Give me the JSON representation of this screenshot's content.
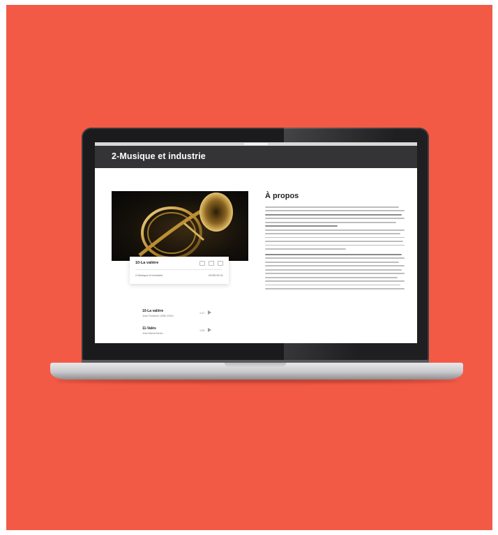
{
  "colors": {
    "background": "#f25a46",
    "hero_bar": "#343436",
    "laptop_bezel": "#1b1b1d"
  },
  "page": {
    "hero_title": "2-Musique et industrie",
    "about_title": "À propos"
  },
  "track_card": {
    "title": "10-La valière",
    "subtitle": "2-Musique et industrie",
    "count": "00/00:00:11"
  },
  "playlist": [
    {
      "title": "10-La valière",
      "subtitle": "Jean Fontanier (1980-2020)",
      "duration": "1:47"
    },
    {
      "title": "11-Valés",
      "subtitle": "Jean-Michel Beréc",
      "duration": "1:55"
    }
  ],
  "icons": {
    "play": "play-icon",
    "card_controls": [
      "expand-icon",
      "share-icon",
      "menu-icon"
    ]
  }
}
